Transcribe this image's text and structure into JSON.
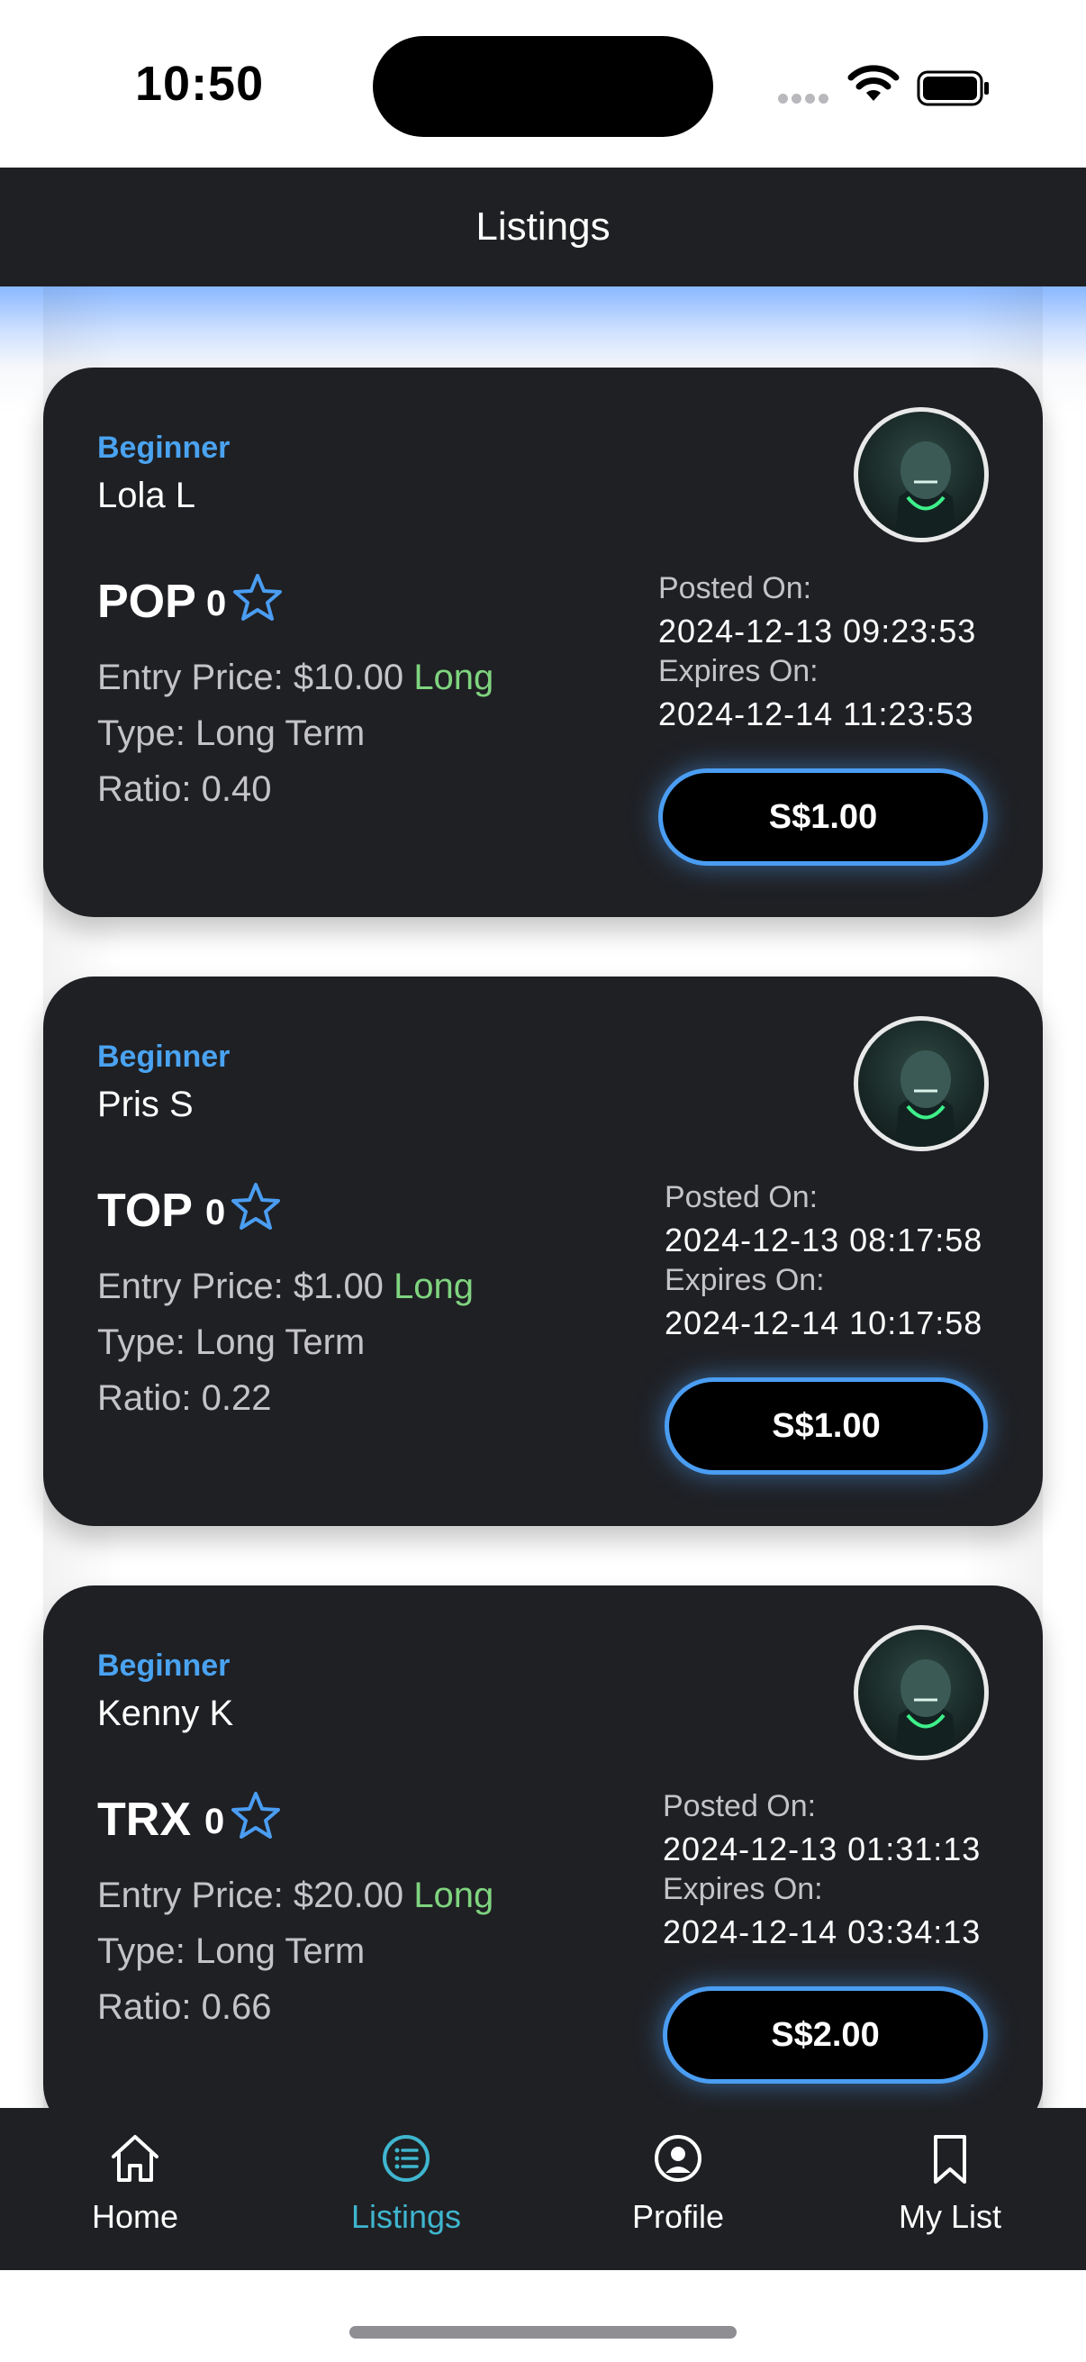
{
  "status_bar": {
    "time": "10:50"
  },
  "header": {
    "title": "Listings"
  },
  "listings": [
    {
      "level": "Beginner",
      "trader": "Lola L",
      "ticker": "POP",
      "stars": "0",
      "entry_label": "Entry Price: $10.00",
      "direction": "Long",
      "type": "Type: Long Term",
      "ratio": "Ratio: 0.40",
      "posted_label": "Posted On:",
      "posted": "2024-12-13 09:23:53",
      "expires_label": "Expires On:",
      "expires": "2024-12-14 11:23:53",
      "price": "S$1.00"
    },
    {
      "level": "Beginner",
      "trader": "Pris S",
      "ticker": "TOP",
      "stars": "0",
      "entry_label": "Entry Price: $1.00",
      "direction": "Long",
      "type": "Type: Long Term",
      "ratio": "Ratio: 0.22",
      "posted_label": "Posted On:",
      "posted": "2024-12-13 08:17:58",
      "expires_label": "Expires On:",
      "expires": "2024-12-14 10:17:58",
      "price": "S$1.00"
    },
    {
      "level": "Beginner",
      "trader": "Kenny K",
      "ticker": "TRX",
      "stars": "0",
      "entry_label": "Entry Price: $20.00",
      "direction": "Long",
      "type": "Type: Long Term",
      "ratio": "Ratio: 0.66",
      "posted_label": "Posted On:",
      "posted": "2024-12-13 01:31:13",
      "expires_label": "Expires On:",
      "expires": "2024-12-14 03:34:13",
      "price": "S$2.00"
    }
  ],
  "tabs": [
    {
      "label": "Home",
      "icon": "home-icon",
      "active": false
    },
    {
      "label": "Listings",
      "icon": "list-icon",
      "active": true
    },
    {
      "label": "Profile",
      "icon": "profile-icon",
      "active": false
    },
    {
      "label": "My List",
      "icon": "bookmark-icon",
      "active": false
    }
  ],
  "colors": {
    "card_bg": "#1f2024",
    "level": "#4aa3f0",
    "long": "#7fd47f",
    "star": "#4a9df2",
    "active_tab": "#3fb6cf"
  }
}
